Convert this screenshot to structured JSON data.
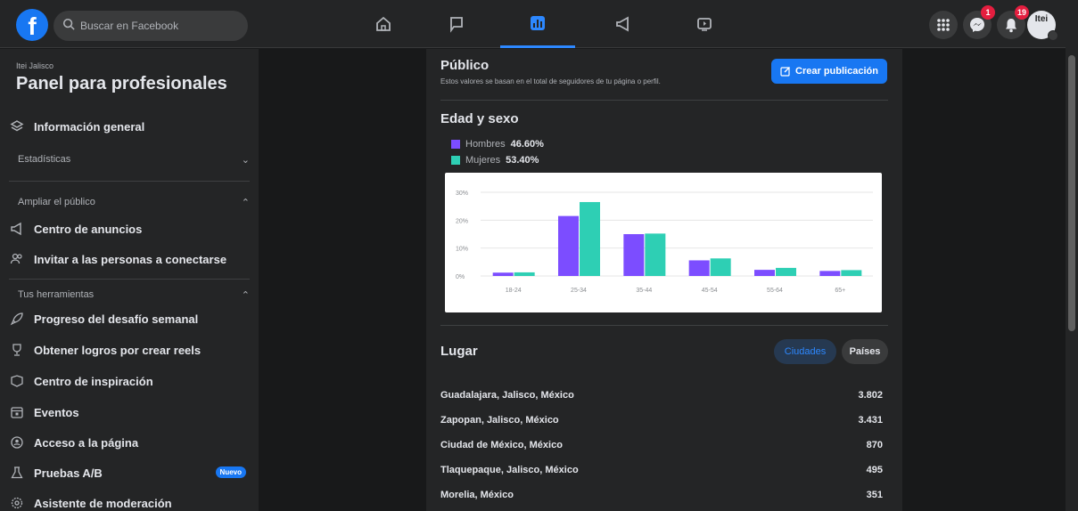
{
  "topbar": {
    "logo": "f",
    "search_placeholder": "Buscar en Facebook",
    "messenger_badge": "1",
    "notifications_badge": "19",
    "avatar_text": "Itei"
  },
  "sidebar": {
    "page_name": "Itei Jalisco",
    "title": "Panel para profesionales",
    "items": [
      {
        "label": "Información general",
        "icon": "overview-icon"
      },
      {
        "label": "Centro de anuncios",
        "icon": "megaphone-icon"
      },
      {
        "label": "Invitar a las personas a conectarse",
        "icon": "people-icon"
      },
      {
        "label": "Progreso del desafío semanal",
        "icon": "rocket-icon"
      },
      {
        "label": "Obtener logros por crear reels",
        "icon": "trophy-icon"
      },
      {
        "label": "Centro de inspiración",
        "icon": "inspiration-icon"
      },
      {
        "label": "Eventos",
        "icon": "calendar-icon"
      },
      {
        "label": "Acceso a la página",
        "icon": "access-icon"
      },
      {
        "label": "Pruebas A/B",
        "icon": "flask-icon"
      },
      {
        "label": "Asistente de moderación",
        "icon": "gear-icon"
      }
    ],
    "sections": {
      "stats": "Estadísticas",
      "expand": "Ampliar el público",
      "tools": "Tus herramientas"
    },
    "new_badge": "Nuevo"
  },
  "main": {
    "public_title": "Público",
    "public_subtitle": "Estos valores se basan en el total de seguidores de tu página o perfil.",
    "create_button": "Crear publicación",
    "age_sex_title": "Edad y sexo",
    "legend": [
      {
        "label": "Hombres",
        "value": "46.60%",
        "color": "#7c4dff"
      },
      {
        "label": "Mujeres",
        "value": "53.40%",
        "color": "#2ecfb4"
      }
    ],
    "place_title": "Lugar",
    "toggle_cities": "Ciudades",
    "toggle_countries": "Países",
    "cities": [
      {
        "name": "Guadalajara, Jalisco, México",
        "value": "3.802"
      },
      {
        "name": "Zapopan, Jalisco, México",
        "value": "3.431"
      },
      {
        "name": "Ciudad de México, México",
        "value": "870"
      },
      {
        "name": "Tlaquepaque, Jalisco, México",
        "value": "495"
      },
      {
        "name": "Morelia, México",
        "value": "351"
      }
    ]
  },
  "chart_data": {
    "type": "bar",
    "categories": [
      "18-24",
      "25-34",
      "35-44",
      "45-54",
      "55-64",
      "65+"
    ],
    "series": [
      {
        "name": "Hombres",
        "values": [
          1.2,
          21.5,
          15,
          5.6,
          2.2,
          1.8
        ],
        "color": "#7c4dff"
      },
      {
        "name": "Mujeres",
        "values": [
          1.3,
          26.5,
          15.2,
          6.3,
          2.9,
          2.1
        ],
        "color": "#2ecfb4"
      }
    ],
    "yticks": [
      "0%",
      "10%",
      "20%",
      "30%"
    ],
    "ylim": [
      0,
      30
    ],
    "grid": true
  }
}
